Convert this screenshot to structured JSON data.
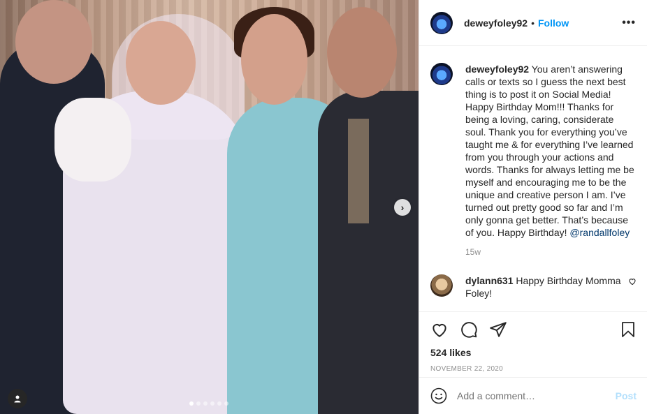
{
  "post": {
    "username": "deweyfoley92",
    "follow_separator": "•",
    "follow_label": "Follow",
    "more_label": "•••",
    "caption": "You aren’t answering calls or texts so I guess the next best thing is to post it on Social Media! Happy Birthday Mom!!! Thanks for being a loving, caring, considerate soul. Thank you for everything you’ve taught me & for everything I’ve learned from you through your actions and words. Thanks for always letting me be myself and encouraging me to be the unique and creative person I am. I’ve turned out pretty good so far and I’m only gonna get better. That’s because of you. Happy Birthday!",
    "mention": "@randallfoley",
    "time_ago": "15w",
    "likes": "524 likes",
    "date": "NOVEMBER 22, 2020",
    "carousel": {
      "total": 6,
      "active": 0
    }
  },
  "comments": [
    {
      "username": "dylann631",
      "text": "Happy Birthday Momma Foley!"
    }
  ],
  "composer": {
    "placeholder": "Add a comment…",
    "post_label": "Post"
  },
  "colors": {
    "accent": "#0095f6",
    "muted": "#8e8e8e",
    "post_disabled": "#b2dffc"
  },
  "icons": [
    "heart-icon",
    "comment-icon",
    "share-icon",
    "bookmark-icon",
    "emoji-icon",
    "chevron-right-icon",
    "user-tag-icon",
    "more-icon"
  ]
}
